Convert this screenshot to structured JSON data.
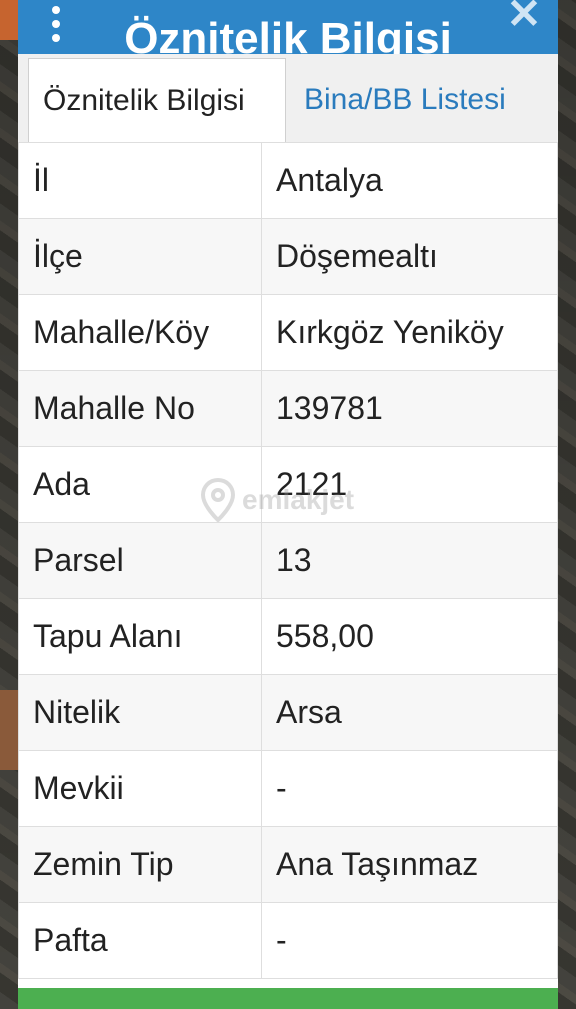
{
  "header": {
    "title": "Öznitelik Bilgisi"
  },
  "tabs": [
    {
      "label": "Öznitelik Bilgisi",
      "active": true
    },
    {
      "label": "Bina/BB Listesi",
      "active": false
    }
  ],
  "rows": [
    {
      "key": "İl",
      "value": "Antalya"
    },
    {
      "key": "İlçe",
      "value": "Döşemealtı"
    },
    {
      "key": "Mahalle/Köy",
      "value": "Kırkgöz Yeniköy"
    },
    {
      "key": "Mahalle No",
      "value": "139781"
    },
    {
      "key": "Ada",
      "value": "2121"
    },
    {
      "key": "Parsel",
      "value": "13"
    },
    {
      "key": "Tapu Alanı",
      "value": "558,00"
    },
    {
      "key": "Nitelik",
      "value": "Arsa"
    },
    {
      "key": "Mevkii",
      "value": "-"
    },
    {
      "key": "Zemin Tip",
      "value": "Ana Taşınmaz"
    },
    {
      "key": "Pafta",
      "value": "-"
    }
  ],
  "watermark": {
    "text": "emlakjet"
  },
  "colors": {
    "header": "#2e86c8",
    "tab_link": "#2a7bbd",
    "footer": "#4caf50"
  },
  "icons": {
    "menu": "kebab-menu-icon",
    "close": "close-icon",
    "watermark": "location-pin-icon"
  }
}
